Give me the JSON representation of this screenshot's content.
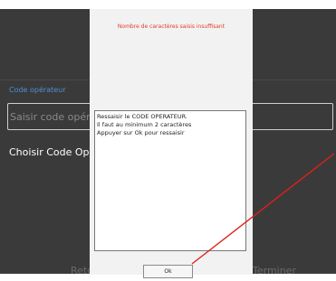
{
  "background": {
    "field_label": "Code opérateur",
    "input_placeholder": "Saisir code opérateur",
    "input_value": "",
    "choose_label": "Choisir Code Opérateur",
    "bottom_left_button": "Retour",
    "bottom_right_button": "Terminer"
  },
  "dialog": {
    "title": "Nombre de caractères saisis insuffisant",
    "message_lines": [
      "Ressaisir le CODE OPERATEUR.",
      "Il faut au minimum 2 caractères",
      "Appuyer sur Ok pour ressaisir"
    ],
    "ok_label": "Ok"
  },
  "colors": {
    "background": "#3a3a3a",
    "dialog_background": "#f2f2f2",
    "title_red": "#e53a2a",
    "label_blue": "#4d8fd6",
    "annotation_arrow": "#e0201a"
  }
}
